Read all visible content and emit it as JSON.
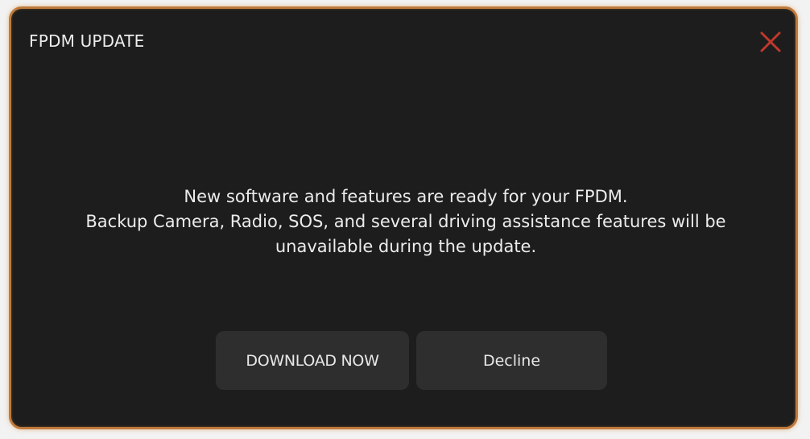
{
  "dialog": {
    "title": "FPDM UPDATE",
    "close_icon": "close-icon",
    "message_lines": [
      "New software and features are ready for your FPDM.",
      "Backup Camera, Radio, SOS, and several driving assistance features will be",
      "unavailable during the update."
    ],
    "buttons": {
      "download_label": "DOWNLOAD NOW",
      "decline_label": "Decline"
    }
  },
  "colors": {
    "border": "#c07a3c",
    "background": "#1d1d1d",
    "button": "#2e2e2e",
    "close_icon": "#c0392b"
  }
}
